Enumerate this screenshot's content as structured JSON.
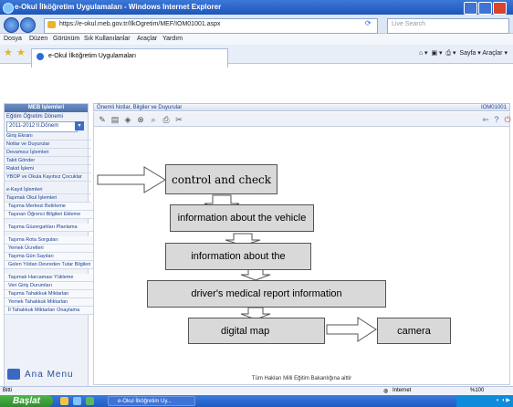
{
  "window": {
    "title": "e-Okul İlköğretim Uygulamaları - Windows Internet Explorer"
  },
  "address": {
    "url": "https://e-okul.meb.gov.tr/IlkOgretim/MEF/IOM01001.aspx",
    "search_placeholder": "Live Search"
  },
  "menu": [
    "Dosya",
    "Düzen",
    "Görünüm",
    "Sık Kullanılanlar",
    "Araçlar",
    "Yardım"
  ],
  "tab": {
    "label": "e-Okul İlköğretim Uygulamaları"
  },
  "ie_tools": {
    "page": "Sayfa",
    "tools": "Araçlar"
  },
  "sidebar": {
    "header": "MEB İşlemleri",
    "period_label": "Eğitim Öğretim Dönemi",
    "period_value": "2011-2012 II.Dönem",
    "items": [
      {
        "label": "Giriş Ekranı",
        "sub": false
      },
      {
        "label": "Notlar ve Duyurular",
        "sub": false
      },
      {
        "label": "Devamsız İşlemleri",
        "sub": false
      },
      {
        "label": "Takit Gönder",
        "sub": false
      },
      {
        "label": "Rakid İşlemi",
        "sub": false
      },
      {
        "label": "YBOP ve Okula Kayıtsız Çocuklar",
        "sub": false
      },
      {
        "label": "e-Kayıt İşlemleri",
        "sub": false
      },
      {
        "label": "Taşımalı Okul İşlemleri",
        "sub": false
      },
      {
        "label": "Taşıma Merkezi Belirleme",
        "sub": true
      },
      {
        "label": "Taşınan Öğrenci Bilgileri Ekleme",
        "sub": true
      },
      {
        "label": "Taşıma Güzergahları Planlama",
        "sub": true
      },
      {
        "label": "Taşıma Rota Sorguları",
        "sub": true
      },
      {
        "label": "Yemek Ücretleri",
        "sub": true
      },
      {
        "label": "Taşıma Gün Sayıları",
        "sub": true
      },
      {
        "label": "Gelen Yıldan Devreden Tutar Bilgileri",
        "sub": true
      },
      {
        "label": "Taşımalı Harcaması Yükleme",
        "sub": true
      },
      {
        "label": "Veri Giriş Durumları",
        "sub": true
      },
      {
        "label": "Taşıma Tahakkuk Miktarları",
        "sub": true
      },
      {
        "label": "Yemek Tahakkuk Miktarları",
        "sub": true
      },
      {
        "label": "İl Tahakkuk Miktarları Onaylama",
        "sub": true
      }
    ],
    "ana_menu": "Ana Menu"
  },
  "content": {
    "title": "Önemli Notlar, Bilgiler ve Duyurular",
    "code": "IOM01001"
  },
  "flow": {
    "control": "control and check",
    "vehicle": "information about the vehicle",
    "about": "information about the",
    "medical": "driver's medical report information",
    "map": "digital map",
    "camera": "camera"
  },
  "footer": "Tüm Hakları Milli Eğitim Bakanlığına aittir",
  "status": {
    "left": "Bitti",
    "zone": "Internet",
    "zoom": "%100"
  },
  "taskbar": {
    "start": "Başlat",
    "task": "e-Okul İlköğretim Uy..."
  }
}
